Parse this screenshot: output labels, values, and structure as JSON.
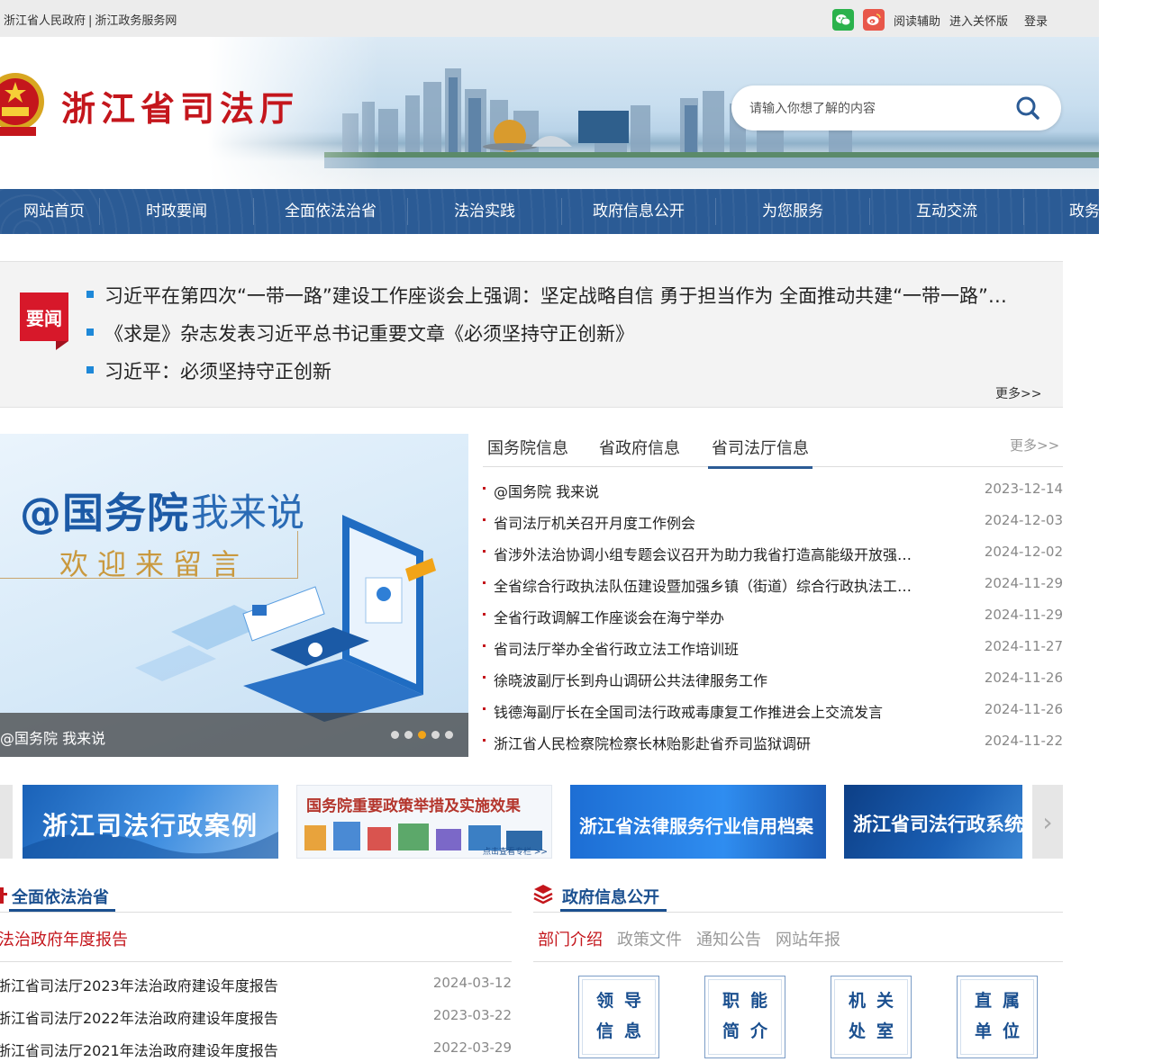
{
  "topbar": {
    "link1": "浙江省人民政府",
    "sep": "|",
    "link2": "浙江政务服务网",
    "reading_aid": "阅读辅助",
    "elder_mode": "进入关怀版",
    "login": "登录"
  },
  "header": {
    "site_title": "浙江省司法厅",
    "search_placeholder": "请输入你想了解的内容"
  },
  "nav": {
    "items": [
      "网站首页",
      "时政要闻",
      "全面依法治省",
      "法治实践",
      "政府信息公开",
      "为您服务",
      "互动交流",
      "政务"
    ]
  },
  "news": {
    "badge": "要闻",
    "headlines": [
      "习近平在第四次“一带一路”建设工作座谈会上强调：坚定战略自信 勇于担当作为 全面推动共建“一带一路”高质量发展",
      "《求是》杂志发表习近平总书记重要文章《必须坚持守正创新》",
      "习近平：必须坚持守正创新"
    ],
    "more": "更多>>"
  },
  "carousel": {
    "title_a": "@国务院",
    "title_b": "我来说",
    "subtitle": "欢迎来留言",
    "caption": "@国务院 我来说",
    "slide_count": 5,
    "active_slide": 3
  },
  "info": {
    "tabs": [
      "国务院信息",
      "省政府信息",
      "省司法厅信息"
    ],
    "active_tab": 2,
    "more": "更多>>",
    "items": [
      {
        "title": "@国务院 我来说",
        "date": "2023-12-14"
      },
      {
        "title": "省司法厅机关召开月度工作例会",
        "date": "2024-12-03"
      },
      {
        "title": "省涉外法治协调小组专题会议召开为助力我省打造高能级开放强省提供法治保障",
        "date": "2024-12-02"
      },
      {
        "title": "全省综合行政执法队伍建设暨加强乡镇（街道）综合行政执法工作会议召开",
        "date": "2024-11-29"
      },
      {
        "title": "全省行政调解工作座谈会在海宁举办",
        "date": "2024-11-29"
      },
      {
        "title": "省司法厅举办全省行政立法工作培训班",
        "date": "2024-11-27"
      },
      {
        "title": "徐晓波副厅长到舟山调研公共法律服务工作",
        "date": "2024-11-26"
      },
      {
        "title": "钱德海副厅长在全国司法行政戒毒康复工作推进会上交流发言",
        "date": "2024-11-26"
      },
      {
        "title": "浙江省人民检察院检察长林贻影赴省乔司监狱调研",
        "date": "2024-11-22"
      }
    ]
  },
  "banners": {
    "b1": "浙江司法行政案例",
    "b2_title": "国务院重要政策举措及实施效果",
    "b2_note": "点击查看专栏 >>",
    "b3": "浙江省法律服务行业信用档案",
    "b4": "浙江省司法行政系统"
  },
  "rule_of_law": {
    "heading": "全面依法治省",
    "sub": "法治政府年度报告",
    "reports": [
      {
        "title": "浙江省司法厅2023年法治政府建设年度报告",
        "date": "2024-03-12"
      },
      {
        "title": "浙江省司法厅2022年法治政府建设年度报告",
        "date": "2023-03-22"
      },
      {
        "title": "浙江省司法厅2021年法治政府建设年度报告",
        "date": "2022-03-29"
      }
    ]
  },
  "gov_info": {
    "heading": "政府信息公开",
    "tabs": [
      "部门介绍",
      "政策文件",
      "通知公告",
      "网站年报"
    ],
    "boxes": [
      {
        "line1": "领导",
        "line2": "信息"
      },
      {
        "line1": "职能",
        "line2": "简介"
      },
      {
        "line1": "机关",
        "line2": "处室"
      },
      {
        "line1": "直属",
        "line2": "单位"
      }
    ]
  },
  "colors": {
    "nav_bg": "#2b5b95",
    "brand_red": "#c4161c",
    "accent_blue": "#1e88d8",
    "carousel_dot_active": "#f2a418"
  }
}
